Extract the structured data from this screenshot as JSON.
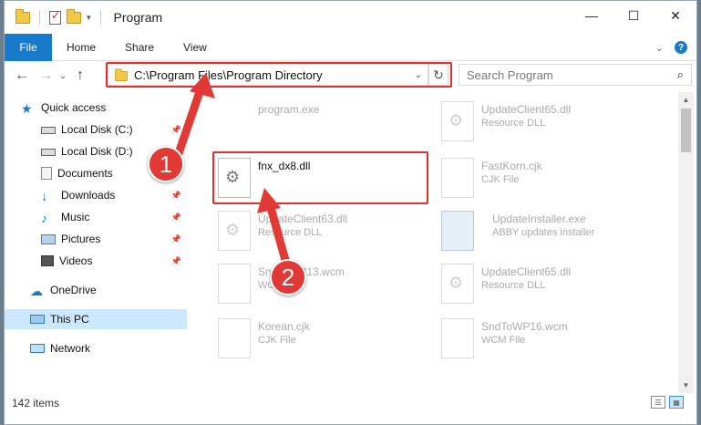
{
  "window": {
    "title": "Program"
  },
  "ribbon": {
    "tabs": [
      "File",
      "Home",
      "Share",
      "View"
    ]
  },
  "address": {
    "path": "C:\\Program Files\\Program Directory"
  },
  "search": {
    "placeholder": "Search Program"
  },
  "sidebar": {
    "items": [
      {
        "label": "Quick access",
        "icon": "star-icon"
      },
      {
        "label": "Local Disk (C:)",
        "icon": "drive-icon"
      },
      {
        "label": "Local Disk (D:)",
        "icon": "drive-icon"
      },
      {
        "label": "Documents",
        "icon": "documents-icon"
      },
      {
        "label": "Downloads",
        "icon": "download-icon"
      },
      {
        "label": "Music",
        "icon": "music-icon"
      },
      {
        "label": "Pictures",
        "icon": "pictures-icon"
      },
      {
        "label": "Videos",
        "icon": "videos-icon"
      },
      {
        "label": "OneDrive",
        "icon": "cloud-icon"
      },
      {
        "label": "This PC",
        "icon": "computer-icon"
      },
      {
        "label": "Network",
        "icon": "network-icon"
      }
    ]
  },
  "files": [
    {
      "name": "program.exe",
      "type": ""
    },
    {
      "name": "UpdateClient65.dll",
      "type": "Resource DLL"
    },
    {
      "name": "fnx_dx8.dll",
      "type": ""
    },
    {
      "name": "FastKorn.cjk",
      "type": "CJK File"
    },
    {
      "name": "UpdateClient63.dll",
      "type": "Resource DLL"
    },
    {
      "name": "UpdateInstaller.exe",
      "type": "ABBY updates installer"
    },
    {
      "name": "SndToWP13.wcm",
      "type": "WCM File"
    },
    {
      "name": "UpdateClient65.dll",
      "type": "Resource DLL"
    },
    {
      "name": "Korean.cjk",
      "type": "CJK File"
    },
    {
      "name": "SndToWP16.wcm",
      "type": "WCM File"
    }
  ],
  "status": {
    "items_count": "142 items"
  },
  "annotations": {
    "step1": "1",
    "step2": "2"
  },
  "colors": {
    "accent": "#1979ca",
    "highlight_red": "#e0312e",
    "selection": "#cce8ff"
  }
}
